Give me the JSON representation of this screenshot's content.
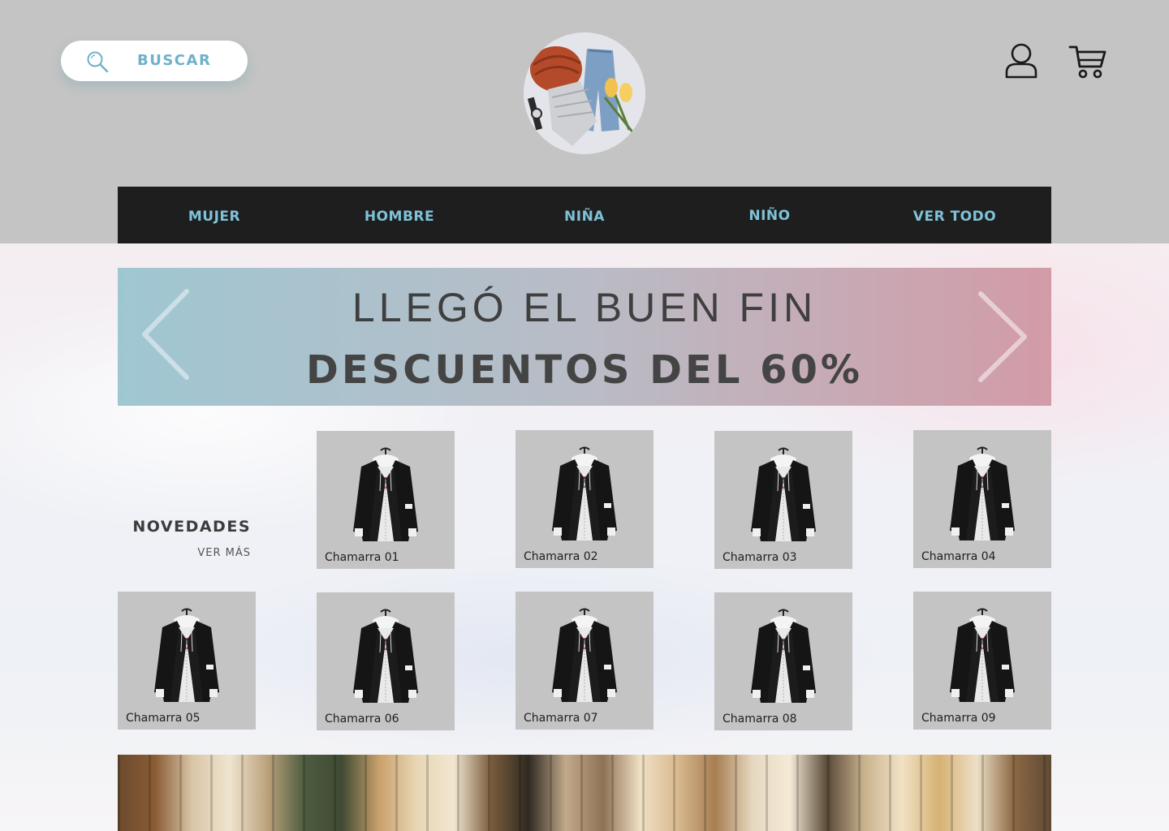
{
  "search": {
    "label": "BUSCAR"
  },
  "nav": {
    "items": [
      {
        "label": "MUJER"
      },
      {
        "label": "HOMBRE"
      },
      {
        "label": "NIÑA"
      },
      {
        "label": "NIÑO"
      },
      {
        "label": "VER TODO"
      }
    ]
  },
  "banner": {
    "line1": "LLEGÓ EL BUEN FIN",
    "line2": "DESCUENTOS DEL 60%"
  },
  "section": {
    "title": "NOVEDADES",
    "see_more": "VER MÁS"
  },
  "products": [
    {
      "name": "Chamarra 01"
    },
    {
      "name": "Chamarra 02"
    },
    {
      "name": "Chamarra 03"
    },
    {
      "name": "Chamarra 04"
    },
    {
      "name": "Chamarra 05"
    },
    {
      "name": "Chamarra 06"
    },
    {
      "name": "Chamarra 07"
    },
    {
      "name": "Chamarra 08"
    },
    {
      "name": "Chamarra 09"
    }
  ],
  "icons": {
    "search": "search-icon",
    "user": "user-icon",
    "cart": "cart-icon",
    "prev": "chevron-left-icon",
    "next": "chevron-right-icon"
  },
  "colors": {
    "header_bg": "#c4c4c4",
    "nav_bg": "#1e1e1e",
    "accent": "#7ec2d8",
    "card_bg": "#c4c4c4"
  }
}
